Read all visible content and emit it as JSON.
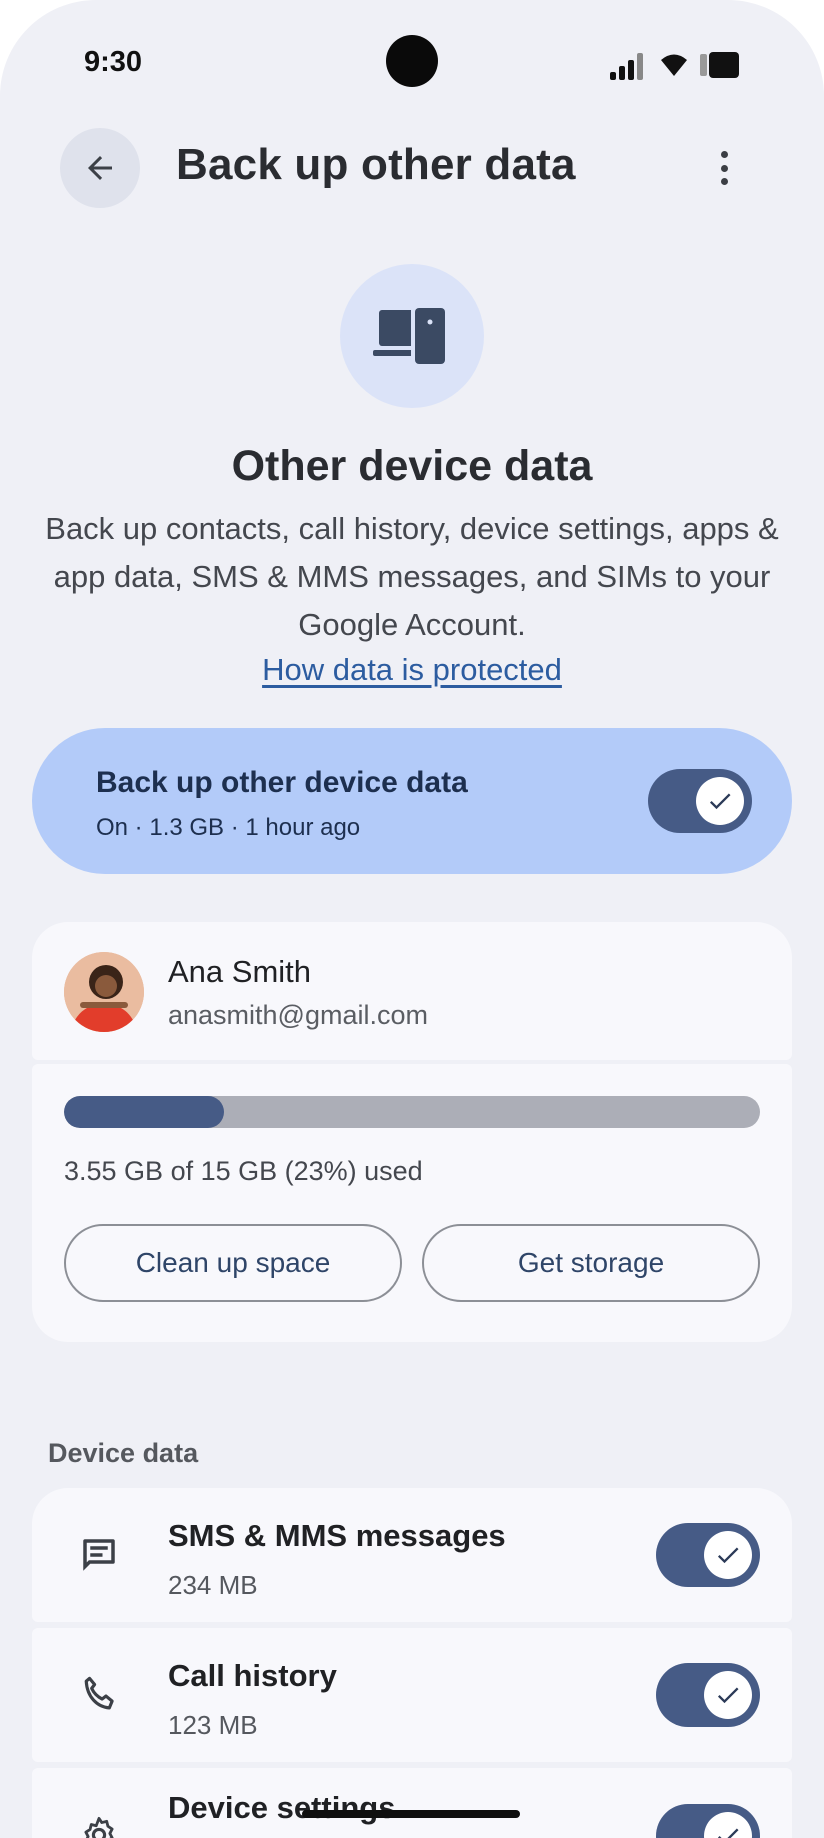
{
  "status_bar": {
    "time": "9:30"
  },
  "header": {
    "title": "Back up other data"
  },
  "hero": {
    "title": "Other device data",
    "description": "Back up contacts, call history, device settings, apps & app data, SMS & MMS messages, and SIMs to your Google Account.",
    "link": "How data is protected"
  },
  "master_toggle": {
    "title": "Back up other device data",
    "subtitle": "On · 1.3 GB · 1 hour ago",
    "enabled": true
  },
  "account": {
    "name": "Ana Smith",
    "email": "anasmith@gmail.com"
  },
  "storage": {
    "used_fraction": 0.23,
    "text": "3.55 GB of 15 GB (23%) used",
    "clean_up_label": "Clean up space",
    "get_storage_label": "Get storage"
  },
  "device_data": {
    "section_label": "Device data",
    "items": [
      {
        "title": "SMS & MMS messages",
        "size": "234 MB",
        "icon": "message-icon",
        "enabled": true
      },
      {
        "title": "Call history",
        "size": "123 MB",
        "icon": "phone-icon",
        "enabled": true
      },
      {
        "title": "Device settings",
        "size": "",
        "icon": "gear-icon",
        "enabled": true
      }
    ]
  },
  "colors": {
    "background": "#eff0f6",
    "accent": "#465b86",
    "master_card": "#b3cbf9",
    "link": "#2c5ca0"
  }
}
